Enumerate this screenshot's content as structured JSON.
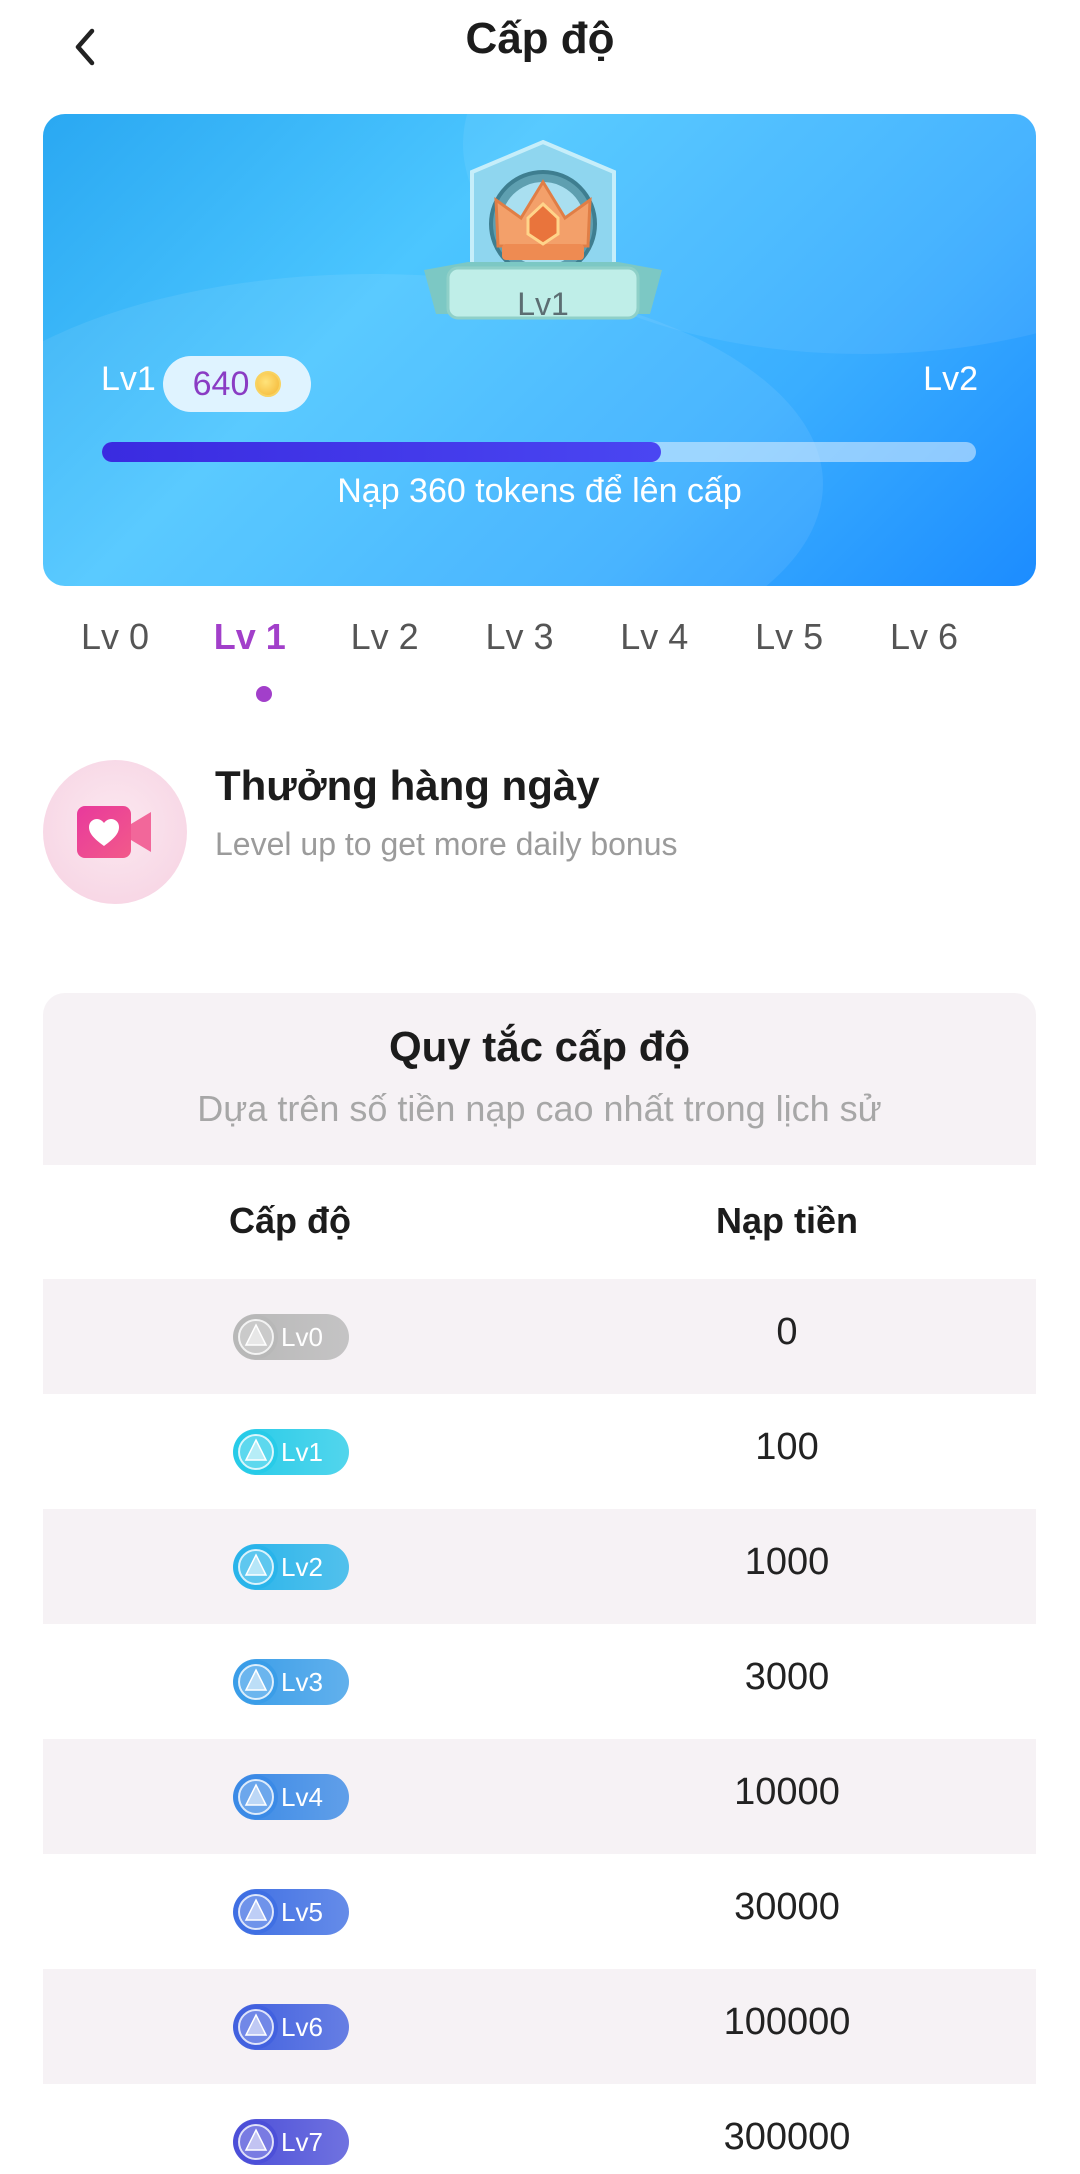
{
  "header": {
    "title": "Cấp độ"
  },
  "hero": {
    "badge_label": "Lv1",
    "current_level": "Lv1",
    "next_level": "Lv2",
    "tokens": "640",
    "progress": 0.64,
    "progress_text": "Nạp 360 tokens để lên cấp"
  },
  "tabs": [
    "Lv 0",
    "Lv 1",
    "Lv 2",
    "Lv 3",
    "Lv 4",
    "Lv 5",
    "Lv 6"
  ],
  "active_tab": 1,
  "reward": {
    "title": "Thưởng hàng ngày",
    "subtitle": "Level up to get more daily bonus"
  },
  "rules": {
    "title": "Quy tắc cấp độ",
    "subtitle": "Dựa trên số tiền nạp cao nhất trong lịch sử",
    "col_level": "Cấp độ",
    "col_amount": "Nạp tiền",
    "rows": [
      {
        "level": "Lv0",
        "amount": "0",
        "color": "#b8b8b8"
      },
      {
        "level": "Lv1",
        "amount": "100",
        "color": "#27cbe8"
      },
      {
        "level": "Lv2",
        "amount": "1000",
        "color": "#29b4ea"
      },
      {
        "level": "Lv3",
        "amount": "3000",
        "color": "#3a9de8"
      },
      {
        "level": "Lv4",
        "amount": "10000",
        "color": "#3b8ae6"
      },
      {
        "level": "Lv5",
        "amount": "30000",
        "color": "#3f6fe3"
      },
      {
        "level": "Lv6",
        "amount": "100000",
        "color": "#4261df"
      },
      {
        "level": "Lv7",
        "amount": "300000",
        "color": "#4c4fd8"
      }
    ]
  }
}
